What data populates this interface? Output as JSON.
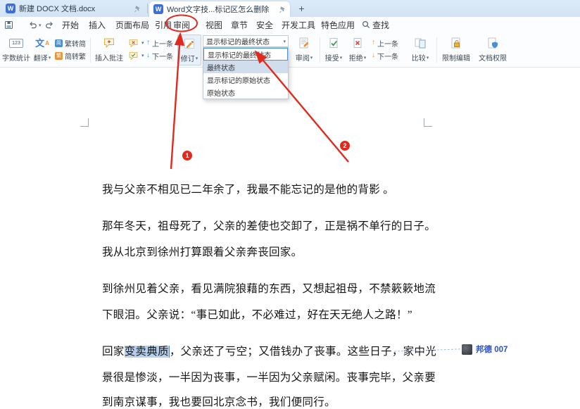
{
  "titlebar": {
    "tab1_label": "新建 DOCX 文档.docx",
    "tab2_label": "Word文字技...标记区怎么删除",
    "new_tab_glyph": "+"
  },
  "menubar": {
    "items": [
      "开始",
      "插入",
      "页面布局",
      "引用",
      "审阅",
      "视图",
      "章节",
      "安全",
      "开发工具",
      "特色应用"
    ],
    "search_label": "查找"
  },
  "ribbon": {
    "word_count": "字数统计",
    "translate": "翻译",
    "trad_to_simp": "繁转简",
    "simp_to_trad": "简转繁",
    "insert_comment": "插入批注",
    "prev_comment": "上一条",
    "next_comment": "下一条",
    "track_changes": "修订",
    "review_menu": "审阅",
    "accept": "接受",
    "reject": "拒绝",
    "prev_change": "上一条",
    "next_change": "下一条",
    "compare": "比较",
    "restrict_edit": "限制编辑",
    "doc_permission": "文档权限"
  },
  "revision_display": {
    "combo_value": "显示标记的最终状态",
    "options": [
      "显示标记的最终状态",
      "最终状态",
      "显示标记的原始状态",
      "原始状态"
    ],
    "highlighted_option": "最终状态"
  },
  "annotations": {
    "step1": "1",
    "step2": "2"
  },
  "document": {
    "lines": {
      "l1": "我与父亲不相见已二年余了，我最不能忘记的是他的背影 。",
      "l2": "那年冬天，祖母死了，父亲的差使也交卸了，正是祸不单行的日子。",
      "l3": "我从北京到徐州打算跟着父亲奔丧回家。",
      "l4": "到徐州见着父亲，看见满院狼藉的东西，又想起祖母，不禁簌簌地流",
      "l5": "下眼泪。父亲说：“事已如此，不必难过，好在天无绝人之路！”",
      "l6_pre": "回家",
      "l6_selected": "变卖典质",
      "l6_post": "，父亲还了亏空；又借钱办了丧事。这些日子，家中光",
      "l7": "景很是惨淡，一半因为丧事，一半因为父亲赋闲。丧事完毕，父亲要",
      "l8": "到南京谋事，我也要回北京念书，我们便同行。"
    },
    "comment_author": "邦德 007"
  },
  "icons": {
    "chevron_down": "▾",
    "word_count_glyph": "123",
    "translate_glyph": "文",
    "translate_sub_glyph": "A",
    "simplified_glyph": "简",
    "traditional_glyph": "繁",
    "up_arrow": "↑",
    "down_arrow": "↓",
    "wps_writer_glyph": "W"
  },
  "colors": {
    "annotation_red": "#e2291d",
    "selection_blue": "#b7d1ec",
    "comment_author_blue": "#2b50c8",
    "titlebar_blue": "#d7e6f5"
  }
}
